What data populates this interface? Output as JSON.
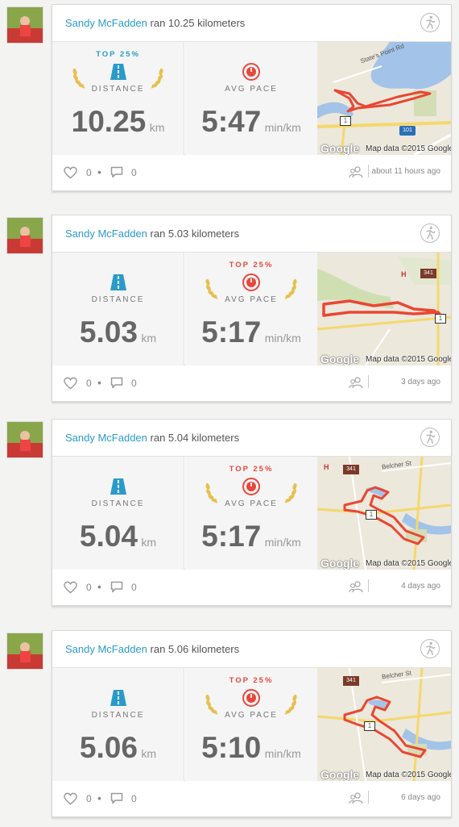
{
  "colors": {
    "link": "#2a9bc9",
    "top_blue": "#2a9bc9",
    "top_red": "#e8473d",
    "route": "#ea4633",
    "gold": "#e6bf4d"
  },
  "activities": [
    {
      "user": "Sandy McFadden",
      "summary": "ran 10.25 kilometers",
      "distance": {
        "rank": "TOP 25%",
        "label": "DISTANCE",
        "value": "10.25",
        "unit": "km"
      },
      "pace": {
        "rank": "",
        "label": "AVG PACE",
        "value": "5:47",
        "unit": "min/km"
      },
      "map": {
        "logo": "Google",
        "credit": "Map data ©2015 Google",
        "road_label": "State's Point Rd",
        "shield_1": "1",
        "shield_2": "101"
      },
      "likes": "0",
      "comments": "0",
      "time": "about 11 hours ago"
    },
    {
      "user": "Sandy McFadden",
      "summary": "ran 5.03 kilometers",
      "distance": {
        "rank": "",
        "label": "DISTANCE",
        "value": "5.03",
        "unit": "km"
      },
      "pace": {
        "rank": "TOP 25%",
        "label": "AVG PACE",
        "value": "5:17",
        "unit": "min/km"
      },
      "map": {
        "logo": "Google",
        "credit": "Map data ©2015 Google",
        "road_label": "",
        "shield_1": "341",
        "shield_2": "1"
      },
      "likes": "0",
      "comments": "0",
      "time": "3 days ago"
    },
    {
      "user": "Sandy McFadden",
      "summary": "ran 5.04 kilometers",
      "distance": {
        "rank": "",
        "label": "DISTANCE",
        "value": "5.04",
        "unit": "km"
      },
      "pace": {
        "rank": "TOP 25%",
        "label": "AVG PACE",
        "value": "5:17",
        "unit": "min/km"
      },
      "map": {
        "logo": "Google",
        "credit": "Map data ©2015 Google",
        "road_label": "Belcher St",
        "shield_1": "341",
        "shield_2": "1"
      },
      "likes": "0",
      "comments": "0",
      "time": "4 days ago"
    },
    {
      "user": "Sandy McFadden",
      "summary": "ran 5.06 kilometers",
      "distance": {
        "rank": "",
        "label": "DISTANCE",
        "value": "5.06",
        "unit": "km"
      },
      "pace": {
        "rank": "TOP 25%",
        "label": "AVG PACE",
        "value": "5:10",
        "unit": "min/km"
      },
      "map": {
        "logo": "Google",
        "credit": "Map data ©2015 Google",
        "road_label": "Belcher St",
        "shield_1": "341",
        "shield_2": "1"
      },
      "likes": "0",
      "comments": "0",
      "time": "6 days ago"
    }
  ]
}
